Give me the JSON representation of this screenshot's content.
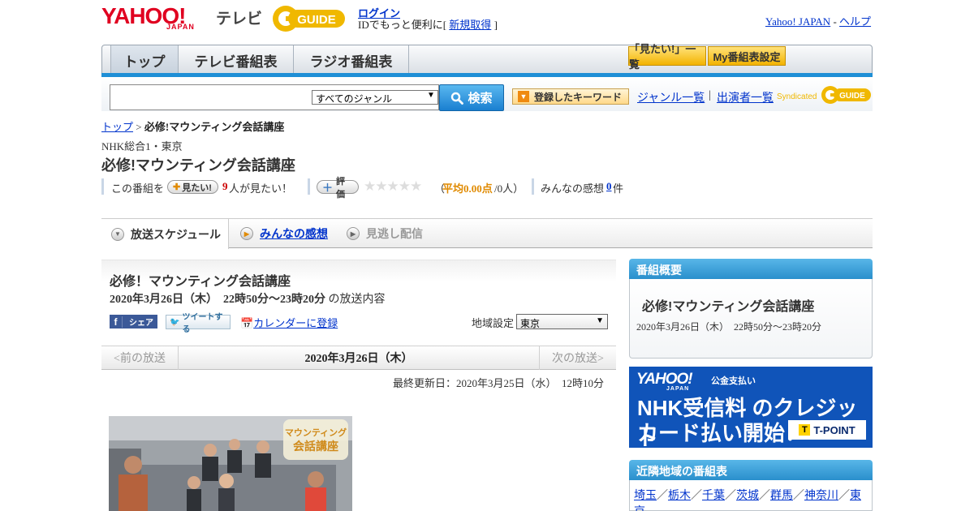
{
  "header": {
    "logo_yahoo": "YAHOO!",
    "logo_japan": "JAPAN",
    "logo_tv": "テレビ",
    "gguide_text": "GUIDE",
    "login_label": "ログイン",
    "login_sub_prefix": "IDでもっと便利に[ ",
    "register_label": "新規取得",
    "login_sub_suffix": " ]",
    "yahoo_japan_link": "Yahoo! JAPAN",
    "separator": " - ",
    "help_link": "ヘルプ"
  },
  "nav": {
    "tabs": [
      {
        "label": "トップ"
      },
      {
        "label": "テレビ番組表"
      },
      {
        "label": "ラジオ番組表"
      }
    ],
    "mitai_list": "「見たい!」一覧",
    "my_schedule": "My番組表設定"
  },
  "search": {
    "genre_selected": "すべてのジャンル",
    "button_label": "検索",
    "keyword_button": "登録したキーワード",
    "genre_list_link": "ジャンル一覧",
    "divider": "|",
    "cast_list_link": "出演者一覧",
    "syndicated": "Syndicated"
  },
  "breadcrumb": {
    "top": "トップ",
    "sep": " > ",
    "current": "必修!マウンティング会話講座"
  },
  "program": {
    "channel": "NHK総合1・東京",
    "title": "必修!マウンティング会話講座",
    "stats": {
      "this_program": "この番組を",
      "mitai_pill": "見たい!",
      "mitai_count": "9",
      "mitai_suffix": "人が見たい！",
      "rating_pill": "評価",
      "stars": "★★★★★",
      "rating_prefix": "（",
      "rating_avg": "平均0.00点",
      "rating_people": "/0人）",
      "impressions_label": "みんなの感想 ",
      "impressions_count": "0",
      "impressions_suffix": "件"
    }
  },
  "sched_tabs": [
    {
      "label": "放送スケジュール"
    },
    {
      "label": "みんなの感想"
    },
    {
      "label": "見逃し配信"
    }
  ],
  "info": {
    "title": "必修！マウンティング会話講座",
    "datetime": "2020年3月26日（木）　22時50分～23時20分",
    "datetime_suffix": " の放送内容",
    "share": "シェア",
    "tweet": "ツイートする",
    "calendar": "カレンダーに登録",
    "region_label": "地域設定",
    "region_value": "東京"
  },
  "date_nav": {
    "prev": "<前の放送",
    "current": "2020年3月26日（木）",
    "next": "次の放送>"
  },
  "last_updated": "最終更新日：2020年3月25日（水）　12時10分",
  "image_overlay": {
    "line1": "マウンティング",
    "line2": "会話講座"
  },
  "sidebar": {
    "summary_head": "番組概要",
    "summary_title": "必修!マウンティング会話講座",
    "summary_datetime": "2020年3月26日（木）　22時50分～23時20分",
    "banner": {
      "yahoo": "YAHOO!",
      "japan": "JAPAN",
      "public": "公金支払い",
      "line1": "NHK受信料 のクレジット",
      "line2": "カード払い開始！",
      "tpoint": "T-POINT"
    },
    "neighbor_head": "近隣地域の番組表",
    "neighbors": [
      "埼玉",
      "栃木",
      "千葉",
      "茨城",
      "群馬",
      "神奈川",
      "東京"
    ],
    "neighbor_sep": "／"
  },
  "colors": {
    "accent_blue": "#1f8fd6",
    "yahoo_red": "#e00020",
    "link": "#0033cc",
    "banner_blue": "#1054b9"
  }
}
